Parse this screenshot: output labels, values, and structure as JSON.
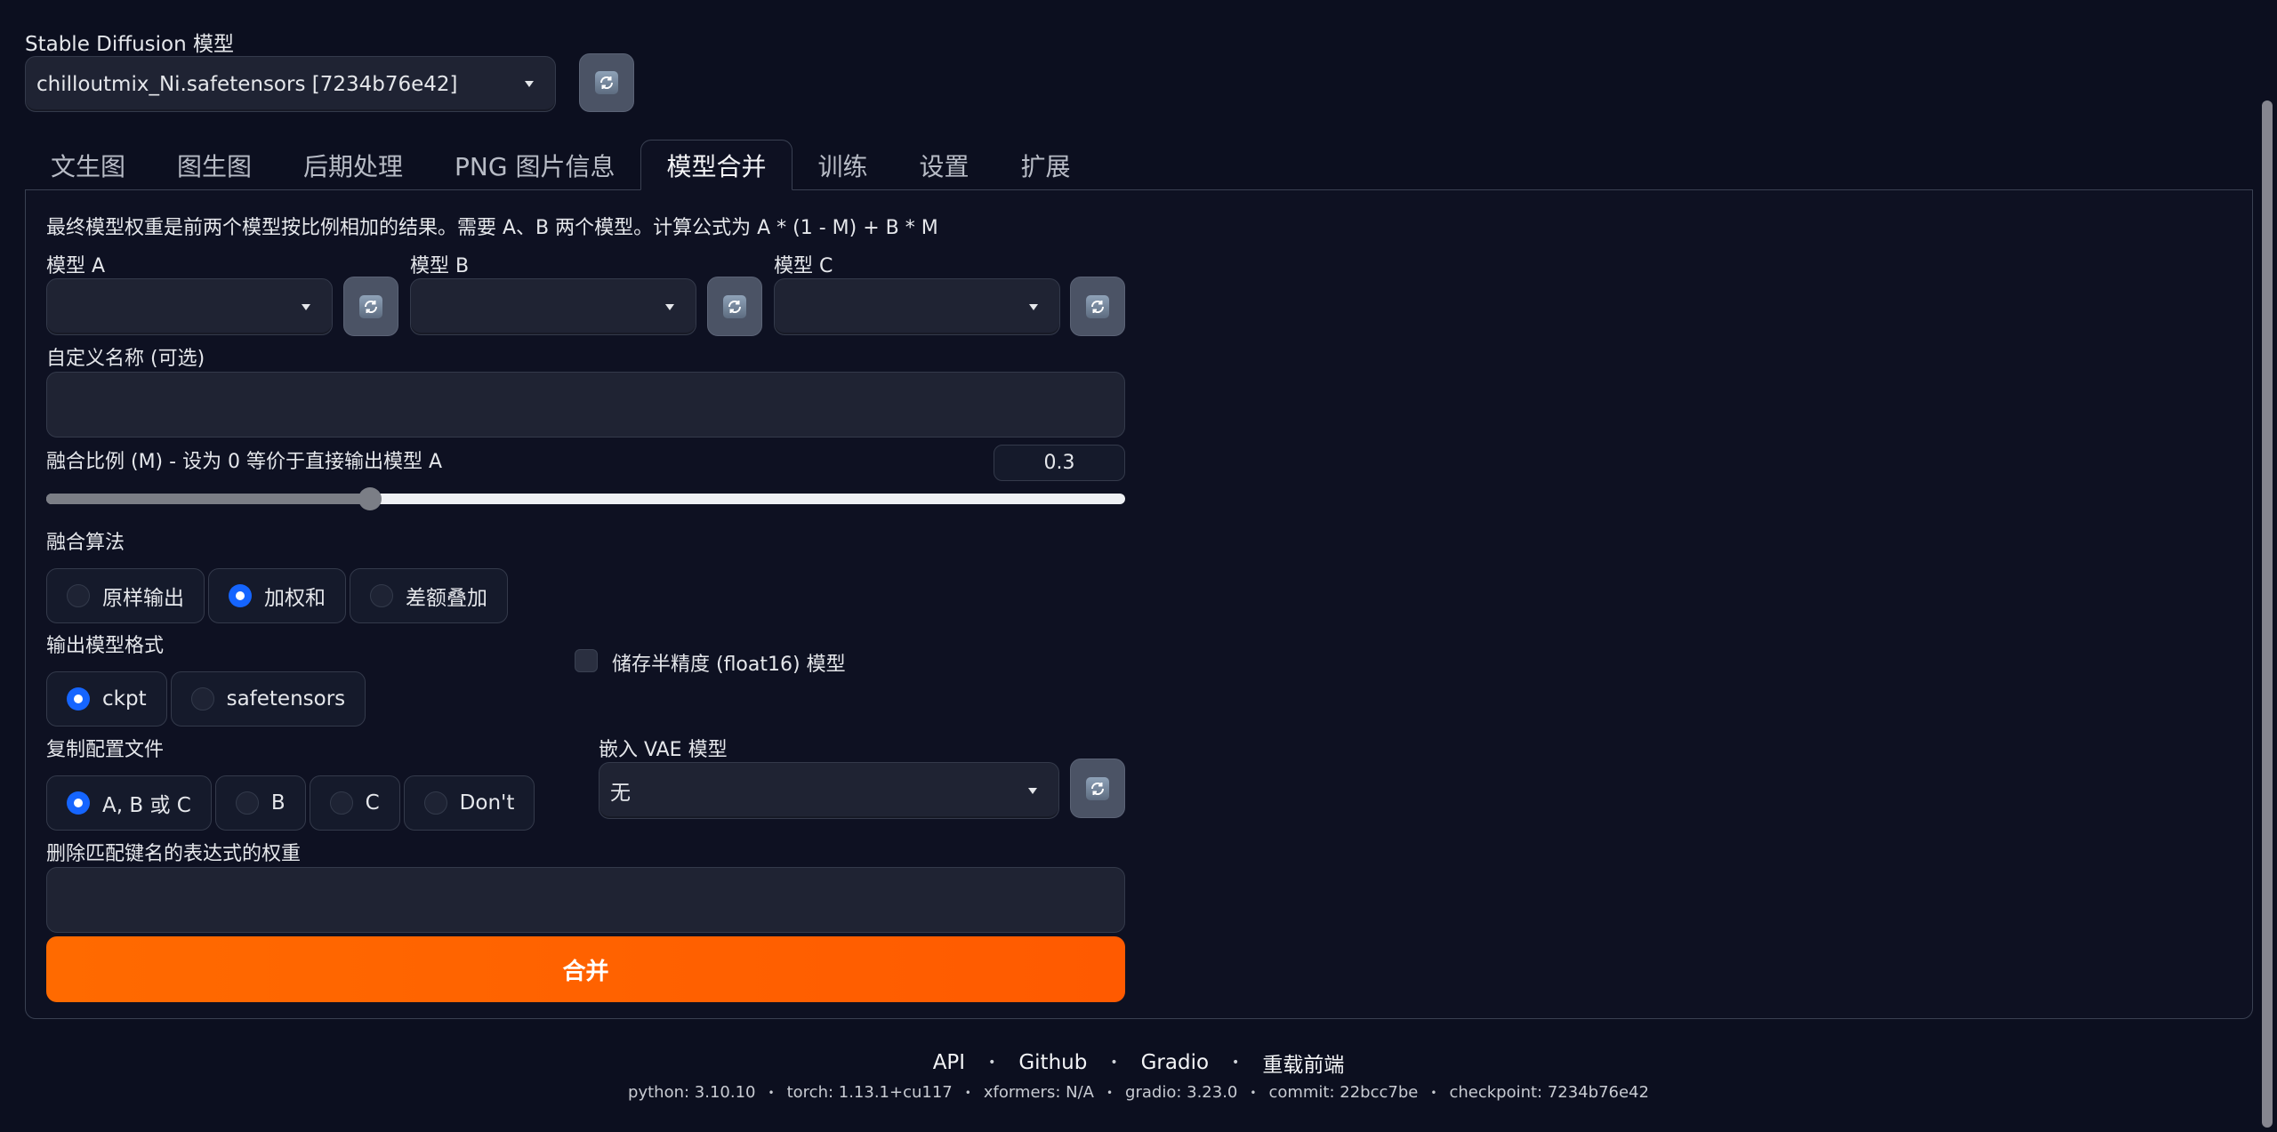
{
  "header": {
    "model_label": "Stable Diffusion 模型",
    "model_value": "chilloutmix_Ni.safetensors [7234b76e42]"
  },
  "tabs": [
    {
      "label": "文生图",
      "active": false
    },
    {
      "label": "图生图",
      "active": false
    },
    {
      "label": "后期处理",
      "active": false
    },
    {
      "label": "PNG 图片信息",
      "active": false
    },
    {
      "label": "模型合并",
      "active": true
    },
    {
      "label": "训练",
      "active": false
    },
    {
      "label": "设置",
      "active": false
    },
    {
      "label": "扩展",
      "active": false
    }
  ],
  "merge": {
    "description": "最终模型权重是前两个模型按比例相加的结果。需要 A、B 两个模型。计算公式为 A * (1 - M) + B * M",
    "model_a_label": "模型 A",
    "model_a_value": "",
    "model_b_label": "模型 B",
    "model_b_value": "",
    "model_c_label": "模型 C",
    "model_c_value": "",
    "custom_name_label": "自定义名称 (可选)",
    "custom_name_value": "",
    "ratio_label": "融合比例 (M) - 设为 0 等价于直接输出模型 A",
    "ratio_value": "0.3",
    "ratio_min": 0,
    "ratio_max": 1,
    "algorithm_label": "融合算法",
    "algorithm_options": [
      "原样输出",
      "加权和",
      "差额叠加"
    ],
    "algorithm_selected": "加权和",
    "format_label": "输出模型格式",
    "format_options": [
      "ckpt",
      "safetensors"
    ],
    "format_selected": "ckpt",
    "half_precision_label": "储存半精度 (float16) 模型",
    "half_precision_checked": false,
    "config_label": "复制配置文件",
    "config_options": [
      "A, B 或 C",
      "B",
      "C",
      "Don't"
    ],
    "config_selected": "A, B 或 C",
    "vae_label": "嵌入 VAE 模型",
    "vae_value": "无",
    "discard_label": "删除匹配键名的表达式的权重",
    "discard_value": "",
    "merge_button": "合并",
    "accent_color": "#ff6a00",
    "radio_checked_color": "#1565ff"
  },
  "footer": {
    "links": [
      "API",
      "Github",
      "Gradio",
      "重载前端"
    ],
    "versions": [
      "python: 3.10.10",
      "torch: 1.13.1+cu117",
      "xformers: N/A",
      "gradio: 3.23.0",
      "commit: 22bcc7be",
      "checkpoint: 7234b76e42"
    ]
  }
}
